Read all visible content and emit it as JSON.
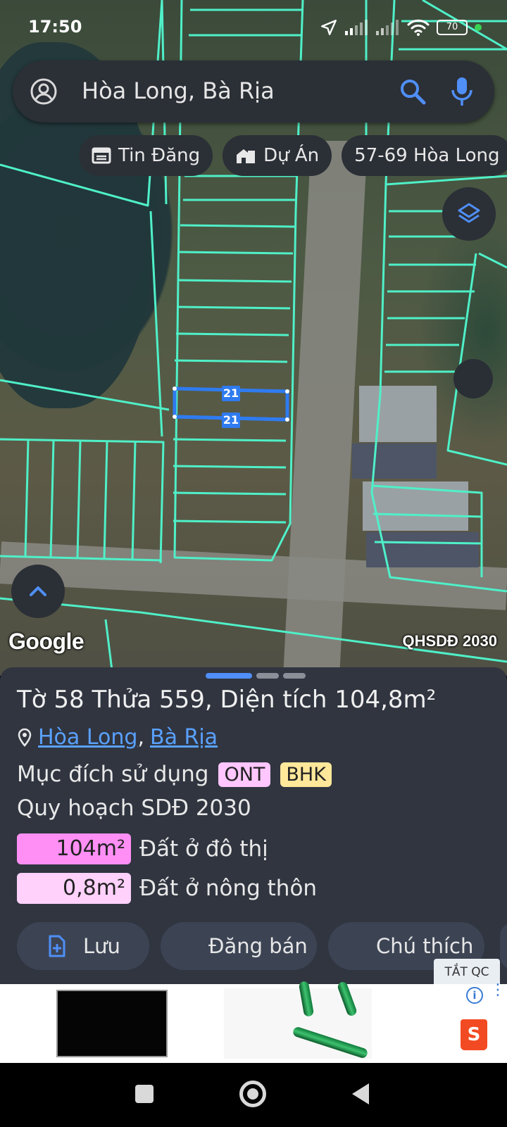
{
  "status_bar": {
    "time": "17:50",
    "battery": "70"
  },
  "search": {
    "query": "Hòa Long, Bà Rịa"
  },
  "chips": [
    {
      "label": "Tin Đăng",
      "icon": "listing-icon"
    },
    {
      "label": "Dự Án",
      "icon": "building-icon"
    },
    {
      "label": "57-69 Hòa Long",
      "icon": ""
    }
  ],
  "map": {
    "selected_plot_labels": [
      "21",
      "21"
    ],
    "attribution": "Google",
    "layer_label": "QHSDĐ 2030"
  },
  "sheet": {
    "title": "Tờ 58 Thửa 559, Diện tích 104,8m²",
    "location": {
      "commune": "Hòa Long",
      "separator": ",",
      "city": "Bà Rịa"
    },
    "purpose_label": "Mục đích sử dụng",
    "purpose_tags": [
      "ONT",
      "BHK"
    ],
    "plan_label": "Quy hoạch SDĐ 2030",
    "areas": [
      {
        "value": "104m²",
        "label": "Đất ở đô thị",
        "color": "#ff8ff5"
      },
      {
        "value": "0,8m²",
        "label": "Đất ở nông thôn",
        "color": "#ffd1fb"
      }
    ],
    "actions": [
      {
        "label": "Lưu",
        "icon": "add-file-icon"
      },
      {
        "label": "Đăng bán",
        "icon": "calendar-listing-icon"
      },
      {
        "label": "Chú thích",
        "icon": "contrast-icon"
      }
    ]
  },
  "ad": {
    "close_label": "TẮT QC",
    "brand_badge": "S",
    "info_badge": "i"
  },
  "colors": {
    "accent": "#4f8ff7",
    "plot_line": "#4ff0c8",
    "sheet_bg": "#303540"
  }
}
